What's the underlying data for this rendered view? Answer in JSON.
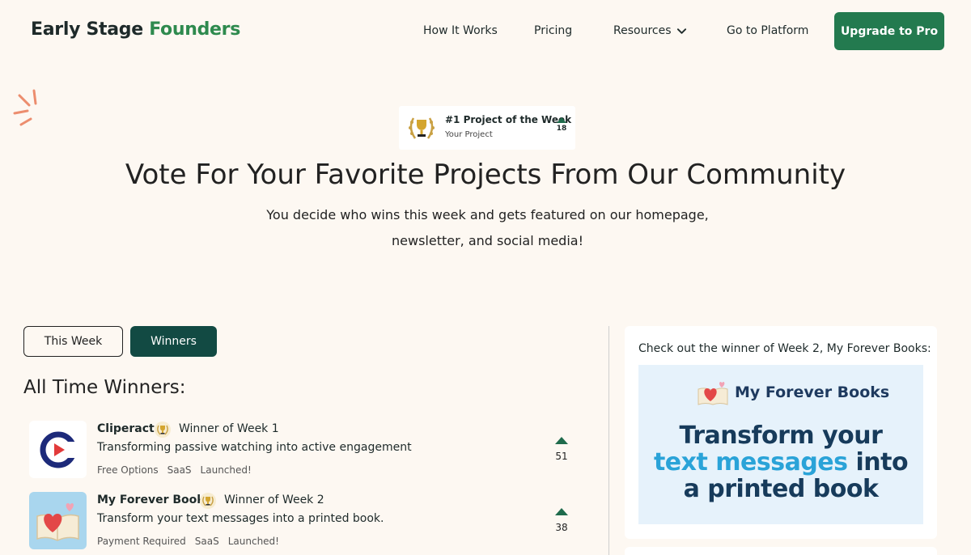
{
  "header": {
    "logo_main": "Early Stage",
    "logo_accent": "Founders",
    "nav": {
      "how_it_works": "How It Works",
      "pricing": "Pricing",
      "resources": "Resources",
      "go_to_platform": "Go to Platform"
    },
    "upgrade_label": "Upgrade to Pro"
  },
  "badge": {
    "title": "#1 Project of the Week",
    "subtitle": "Your Project",
    "votes": "18"
  },
  "hero": {
    "title": "Vote For Your Favorite Projects From Our Community",
    "subtitle": "You decide who wins this week and gets featured on our homepage, newsletter, and social media!"
  },
  "tabs": {
    "this_week": "This Week",
    "winners": "Winners",
    "active": "winners"
  },
  "section_title": "All Time Winners:",
  "winners": [
    {
      "name": "Cliperact",
      "winner_text": "Winner of Week 1",
      "description": "Transforming passive watching into active engagement",
      "tags": [
        "Free Options",
        "SaaS",
        "Launched!"
      ],
      "votes": "51"
    },
    {
      "name": "My Forever Books",
      "winner_text": "Winner of Week 2",
      "description": "Transform your text messages into a printed book.",
      "tags": [
        "Payment Required",
        "SaaS",
        "Launched!"
      ],
      "votes": "38"
    }
  ],
  "side_card": {
    "text": "Check out the winner of Week 2, My Forever Books:",
    "promo_brand": "My Forever Books",
    "promo_line1": "Transform your",
    "promo_line2_blue": "text messages",
    "promo_line2_rest": " into",
    "promo_line3": "a printed book"
  },
  "colors": {
    "background": "#fdf8f2",
    "brand_green": "#2e8a4e",
    "upgrade_button": "#237a4f",
    "active_tab": "#124a43",
    "vote_arrow": "#1f6b4c",
    "promo_bg": "#e6f2fb",
    "promo_navy": "#173b5b",
    "promo_blue": "#2aa3d8"
  },
  "icons": [
    "chevron-down-icon",
    "trophy-wreath-icon",
    "upvote-icon",
    "medal-icon",
    "heart-book-icon",
    "cliperact-logo-icon"
  ]
}
